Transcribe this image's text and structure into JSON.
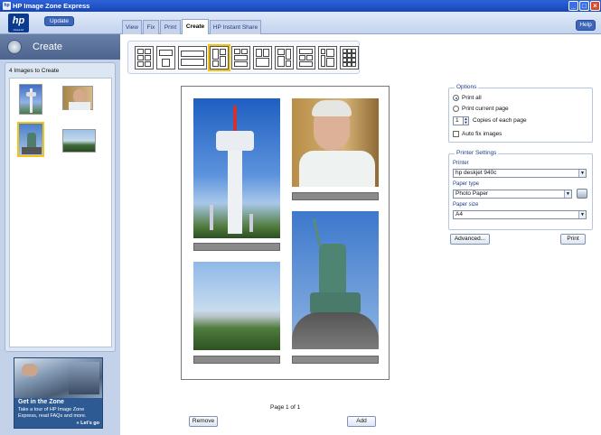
{
  "window": {
    "title": "HP Image Zone Express",
    "minimize": "_",
    "maximize": "□",
    "close": "×"
  },
  "toolbar": {
    "logo_text": "hp",
    "logo_sub": "invent",
    "update_label": "Update",
    "tabs": [
      {
        "label": "View",
        "active": false
      },
      {
        "label": "Fix",
        "active": false
      },
      {
        "label": "Print",
        "active": false
      },
      {
        "label": "Create",
        "active": true
      },
      {
        "label": "HP Instant Share",
        "active": false
      }
    ],
    "help_label": "Help"
  },
  "left_panel": {
    "header": "Create",
    "count_text": "4 Images to Create",
    "promo": {
      "title": "Get in the Zone",
      "text": "Take a tour of HP Image Zone Express, read FAQs and more.",
      "link": "» Let's go"
    }
  },
  "layouts": {
    "count": 10,
    "selected_index": 3
  },
  "canvas": {
    "page_text": "Page 1 of 1",
    "remove_label": "Remove",
    "add_label": "Add"
  },
  "options": {
    "title": "Options",
    "print_all": "Print all",
    "print_current": "Print current page",
    "copies_value": "1",
    "copies_label": "Copies of each page",
    "auto_fix": "Auto fix images",
    "print_all_selected": true,
    "auto_fix_checked": false
  },
  "printer_settings": {
    "title": "Printer Settings",
    "printer_label": "Printer",
    "printer_value": "hp deskjet 940c",
    "paper_type_label": "Paper type",
    "paper_type_value": "Photo Paper",
    "paper_size_label": "Paper size",
    "paper_size_value": "A4"
  },
  "actions": {
    "advanced_label": "Advanced...",
    "print_label": "Print"
  },
  "colors": {
    "accent": "#f0c419",
    "titlebar": "#2e63d8",
    "panel": "#c3d2e8"
  }
}
